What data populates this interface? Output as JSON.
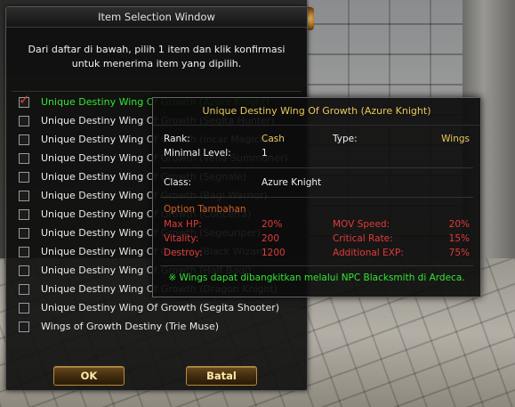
{
  "window": {
    "title": "Item Selection Window",
    "description": "Dari daftar di bawah, pilih 1 item dan klik konfirmasi untuk menerima item yang dipilih.",
    "items": [
      {
        "label": "Unique Destiny Wing Of Growth (Azure Knight)",
        "checked": true
      },
      {
        "label": "Unique Destiny Wing Of Growth (Segita Hunter)",
        "checked": false
      },
      {
        "label": "Unique Destiny Wing Of Growth (Incar Magician)",
        "checked": false
      },
      {
        "label": "Unique Destiny Wing Of Growth (Vena Summoner)",
        "checked": false
      },
      {
        "label": "Unique Destiny Wing Of Growth (Segnale)",
        "checked": false
      },
      {
        "label": "Unique Destiny Wing Of Growth (Bagi Warrior)",
        "checked": false
      },
      {
        "label": "Unique Destiny Wing Of Growth (Concerra)",
        "checked": false
      },
      {
        "label": "Unique Destiny Wing Of Growth (Segeuriper)",
        "checked": false
      },
      {
        "label": "Unique Destiny Wing Of Growth (Black Wizard)",
        "checked": false
      },
      {
        "label": "Unique Destiny Wing Of Growth (Half Bagi)",
        "checked": false
      },
      {
        "label": "Unique Destiny Wing Of Growth (Dragon Knight)",
        "checked": false
      },
      {
        "label": "Unique Destiny Wing Of Growth (Segita Shooter)",
        "checked": false
      },
      {
        "label": "Wings of Growth Destiny (Trie Muse)",
        "checked": false
      }
    ],
    "ok_label": "OK",
    "cancel_label": "Batal"
  },
  "tooltip": {
    "title": "Unique Destiny Wing Of Growth (Azure Knight)",
    "rank_label": "Rank:",
    "rank_value": "Cash",
    "type_label": "Type:",
    "type_value": "Wings",
    "min_level_label": "Minimal Level:",
    "min_level_value": "1",
    "class_label": "Class:",
    "class_value": "Azure Knight",
    "option_header": "Option Tambahan",
    "stats": [
      {
        "label": "Max HP:",
        "value": "20%",
        "label2": "MOV Speed:",
        "value2": "20%"
      },
      {
        "label": "Vitality:",
        "value": "200",
        "label2": "Critical Rate:",
        "value2": "15%"
      },
      {
        "label": "Destroy:",
        "value": "1200",
        "label2": "Additional EXP:",
        "value2": "75%"
      }
    ],
    "note": "※ Wings dapat dibangkitkan melalui NPC Blacksmith di Ardeca."
  },
  "colors": {
    "selected_item": "#32e632",
    "gold_text": "#e8c85a",
    "stat_red": "#e23a3a",
    "option_header": "#d2602a"
  }
}
